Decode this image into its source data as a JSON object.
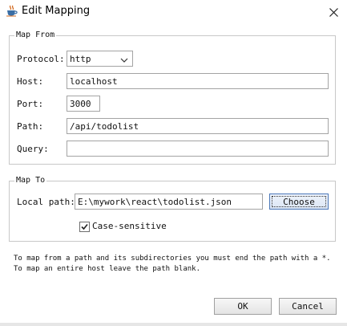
{
  "window": {
    "title": "Edit Mapping",
    "app_icon": "java-cup-icon",
    "close_icon": "close-x-icon"
  },
  "map_from": {
    "title": "Map From",
    "protocol": {
      "label": "Protocol:",
      "value": "http",
      "icon": "chevron-down-icon"
    },
    "host": {
      "label": "Host:",
      "value": "localhost"
    },
    "port": {
      "label": "Port:",
      "value": "3000"
    },
    "path": {
      "label": "Path:",
      "value": "/api/todolist"
    },
    "query": {
      "label": "Query:",
      "value": ""
    }
  },
  "map_to": {
    "title": "Map To",
    "local_path": {
      "label": "Local path:",
      "value": "E:\\mywork\\react\\todolist.json"
    },
    "choose_label": "Choose",
    "case_sensitive": {
      "label": "Case-sensitive",
      "checked": true
    }
  },
  "hint": "To map from a path and its subdirectories you must end the path with a *. To map an entire host leave the path blank.",
  "buttons": {
    "ok_label": "OK",
    "cancel_label": "Cancel"
  }
}
